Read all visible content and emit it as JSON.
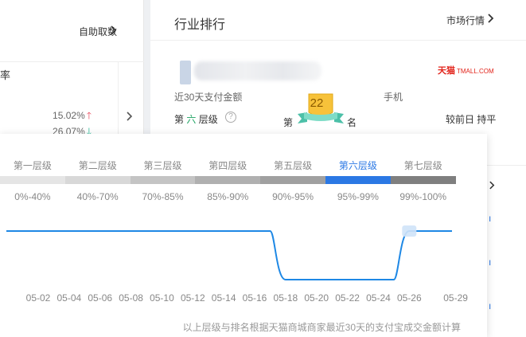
{
  "left_card": {
    "self_link": "自助取数",
    "rate_label": "率",
    "value1": "15.02%",
    "value2": "26.07%"
  },
  "right_card": {
    "title": "行业排行",
    "market_link": "市场行情",
    "tmall_logo_cn": "天猫",
    "tmall_logo_en": "TMALL.COM",
    "pay_label": "近30天支付金额",
    "category": "手机",
    "tier_prefix": "第",
    "tier_num": "六",
    "tier_suffix": "层级",
    "rank_prefix": "第",
    "rank_value": "22",
    "rank_suffix": "名",
    "compare": "较前日 持平"
  },
  "tiers": [
    {
      "name": "第一层级",
      "range": "0%-40%",
      "color": "#e5e5e5",
      "active": false
    },
    {
      "name": "第二层级",
      "range": "40%-70%",
      "color": "#d8d8d8",
      "active": false
    },
    {
      "name": "第三层级",
      "range": "70%-85%",
      "color": "#c4c4c4",
      "active": false
    },
    {
      "name": "第四层级",
      "range": "85%-90%",
      "color": "#b0b0b0",
      "active": false
    },
    {
      "name": "第五层级",
      "range": "90%-95%",
      "color": "#a0a0a0",
      "active": false
    },
    {
      "name": "第六层级",
      "range": "95%-99%",
      "color": "#2b78e4",
      "active": true
    },
    {
      "name": "第七层级",
      "range": "99%-100%",
      "color": "#7f7f7f",
      "active": false
    }
  ],
  "chart_data": {
    "type": "line",
    "x": [
      "05-02",
      "05-04",
      "05-06",
      "05-08",
      "05-10",
      "05-12",
      "05-14",
      "05-16",
      "05-18",
      "05-20",
      "05-22",
      "05-24",
      "05-26",
      "05-29"
    ],
    "series": [
      {
        "color": "#1e88e5",
        "points": [
          [
            "05-01",
            6
          ],
          [
            "05-16",
            6
          ],
          [
            "05-17",
            6
          ],
          [
            "05-18",
            5
          ],
          [
            "05-20",
            5
          ],
          [
            "05-22",
            5
          ],
          [
            "05-24",
            5
          ],
          [
            "05-25",
            5
          ],
          [
            "05-26",
            6
          ],
          [
            "05-29",
            6
          ]
        ]
      }
    ],
    "highlight": "05-26"
  },
  "footnote": "以上层级与排名根据天猫商城商家最近30天的支付宝成交金额计算"
}
